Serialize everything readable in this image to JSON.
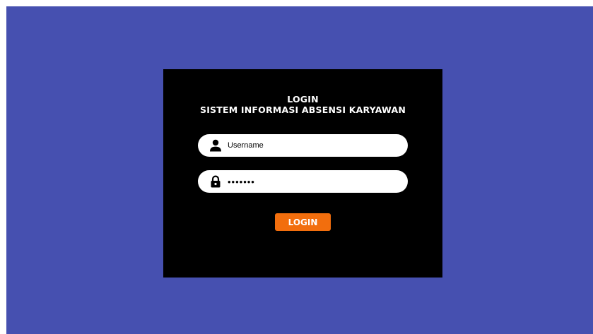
{
  "colors": {
    "background": "#4650b0",
    "panel": "#000000",
    "field": "#ffffff",
    "button": "#f26e0d",
    "text_light": "#ffffff"
  },
  "header": {
    "title_line1": "LOGIN",
    "title_line2": "SISTEM INFORMASI ABSENSI KARYAWAN"
  },
  "username": {
    "icon": "user-icon",
    "value": "",
    "placeholder": "Username"
  },
  "password": {
    "icon": "lock-icon",
    "value": "•••••••",
    "placeholder": ""
  },
  "login_button": {
    "label": "LOGIN"
  }
}
